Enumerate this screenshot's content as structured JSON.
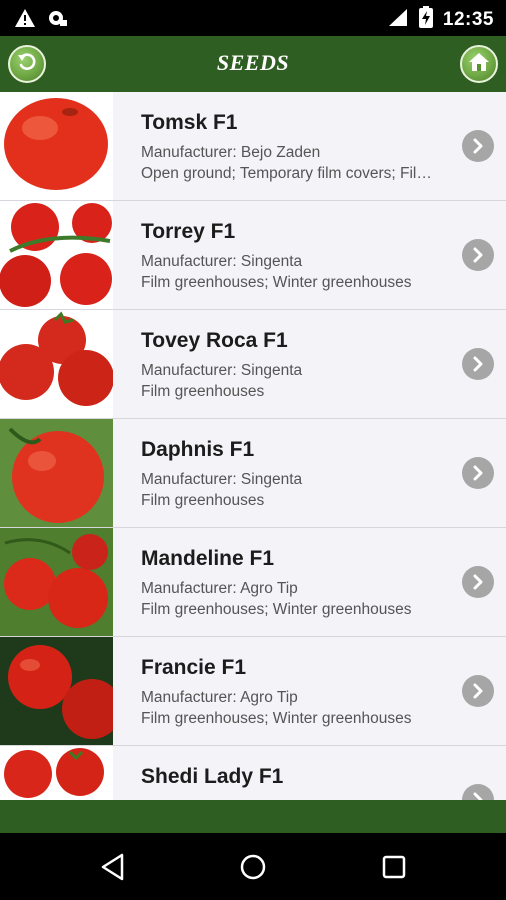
{
  "status_bar": {
    "time": "12:35",
    "icons": [
      "warning-icon",
      "notification-icon",
      "signal-icon",
      "battery-charging-icon"
    ]
  },
  "app_bar": {
    "title": "SEEDS",
    "back_icon": "back-arrow-icon",
    "home_icon": "home-icon"
  },
  "items": [
    {
      "name": "Tomsk F1",
      "manufacturer": "Manufacturer: Bejo Zaden",
      "conditions": "Open ground; Temporary film covers; Fil…"
    },
    {
      "name": "Torrey F1",
      "manufacturer": "Manufacturer: Singenta",
      "conditions": "Film greenhouses; Winter greenhouses"
    },
    {
      "name": "Tovey Roca F1",
      "manufacturer": "Manufacturer: Singenta",
      "conditions": "Film greenhouses"
    },
    {
      "name": "Daphnis F1",
      "manufacturer": "Manufacturer: Singenta",
      "conditions": "Film greenhouses"
    },
    {
      "name": "Mandeline F1",
      "manufacturer": "Manufacturer: Agro Tip",
      "conditions": "Film greenhouses; Winter greenhouses"
    },
    {
      "name": "Francie F1",
      "manufacturer": "Manufacturer: Agro Tip",
      "conditions": "Film greenhouses; Winter greenhouses"
    },
    {
      "name": "Shedi Lady F1",
      "manufacturer": "",
      "conditions": ""
    }
  ],
  "colors": {
    "accent_green": "#2f5e22",
    "list_background": "#f3f3f8",
    "chevron_gray": "#a6a6a6"
  },
  "nav_bar": {
    "icons": [
      "nav-back-icon",
      "nav-home-icon",
      "nav-recents-icon"
    ]
  }
}
